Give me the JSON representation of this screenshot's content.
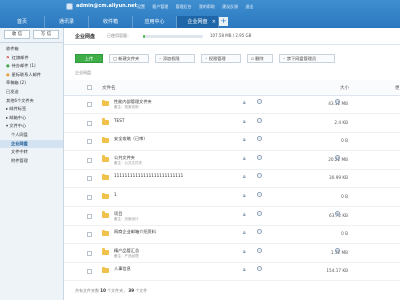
{
  "header": {
    "account": "admin@cm.aliyun.net",
    "links": [
      "设置",
      "客户管理",
      "管理后台",
      "我的帮助",
      "建议反馈",
      "退出"
    ]
  },
  "tabs": [
    {
      "label": "首页"
    },
    {
      "label": "通讯录"
    },
    {
      "label": "收件箱"
    },
    {
      "label": "应用中心"
    },
    {
      "label": "企业网盘",
      "active": true
    }
  ],
  "tab_add_label": "+",
  "sidebar": {
    "buttons": [
      "收 信",
      "写 信"
    ],
    "items": [
      {
        "label": "收件箱",
        "level": 0
      },
      {
        "label": "红旗邮件",
        "level": 0,
        "mark": "flag"
      },
      {
        "label": "待办邮件 (1)",
        "level": 0,
        "mark": "dotg"
      },
      {
        "label": "星标联系人邮件",
        "level": 0,
        "mark": "doty"
      },
      {
        "label": "草稿箱 (2)",
        "level": 0
      },
      {
        "label": "已发送",
        "level": 0
      },
      {
        "label": "其他6个文件夹",
        "level": 0
      },
      {
        "label": "▸ 邮件标签",
        "level": 0
      },
      {
        "label": "▸ 邮箱中心",
        "level": 0
      },
      {
        "label": "▾ 文件中心",
        "level": 0
      },
      {
        "label": "个人网盘",
        "level": 1
      },
      {
        "label": "企业网盘",
        "level": 1,
        "active": true
      },
      {
        "label": "文件中转",
        "level": 1
      },
      {
        "label": "附件管理",
        "level": 1
      }
    ]
  },
  "main": {
    "title": "企业网盘",
    "quota_label": "已使用容量：",
    "quota_fraction": 0.04,
    "quota_text": "107.58 MB / 2.95 GB",
    "toolbar": {
      "upload": "上传",
      "new_folder": "新建文件夹",
      "add_member": "添加权限",
      "permissions": "权限管理",
      "delete": "删除",
      "more": "禁下网盘管理员"
    },
    "breadcrumb": "企业网盘",
    "columns": {
      "name": "文件名",
      "size": "大小",
      "time": "更"
    },
    "files": [
      {
        "name": "性能内部管理文件夹",
        "sub": "备注：档案说明",
        "size": "43.12 MB"
      },
      {
        "name": "TEST",
        "sub": "",
        "size": "2.4 KB"
      },
      {
        "name": "安全攻略（已审）",
        "sub": "",
        "size": "0 B"
      },
      {
        "name": "公共文件夹",
        "sub": "备注：公共文件夹",
        "size": "20.22 MB"
      },
      {
        "name": "11111111111111111111111111",
        "sub": "",
        "size": "30.99 KB"
      },
      {
        "name": "1",
        "sub": "",
        "size": "0 B"
      },
      {
        "name": "项目",
        "sub": "备注：页面设计",
        "size": "63.72 KB"
      },
      {
        "name": "网商企业邮箱介绍资料",
        "sub": "",
        "size": "0 B"
      },
      {
        "name": "精产品管汇总",
        "sub": "备注：产品经理",
        "size": "1.32 MB"
      },
      {
        "name": "人事信息",
        "sub": "",
        "size": "154.17 KB"
      }
    ],
    "footer": {
      "prefix": "共有文件夹数",
      "folders": "10",
      "mid": "个文件夹，",
      "count": "39",
      "suffix": "个文件"
    }
  },
  "colors": {
    "brand": "#2c78bf",
    "primary_button": "#3fae49",
    "folder": "#f0c14b"
  }
}
